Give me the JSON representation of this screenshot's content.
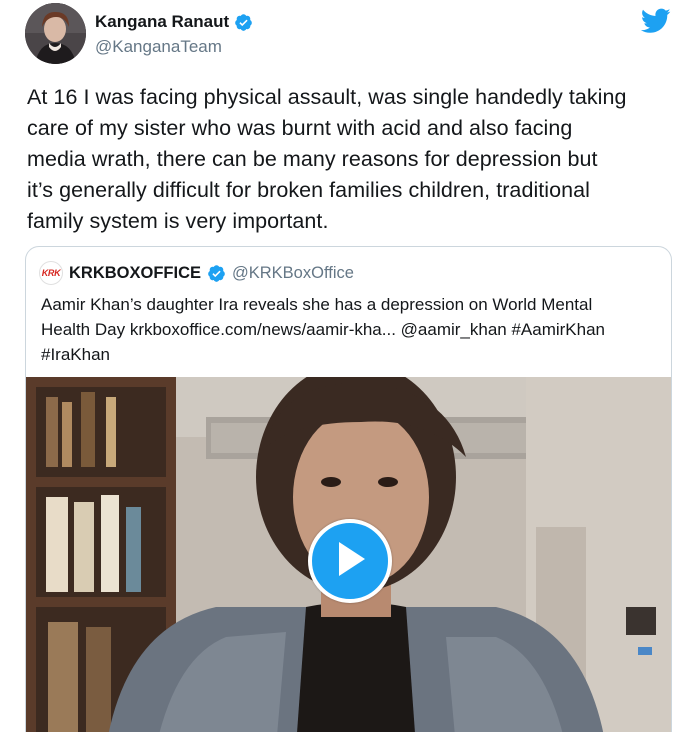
{
  "author": {
    "display_name": "Kangana Ranaut",
    "handle": "@KanganaTeam",
    "verified_icon": "verified-badge-icon"
  },
  "tweet": {
    "lines": [
      "At 16 I was facing physical assault, was single handedly taking",
      "care of my sister who was burnt with acid and also facing",
      "media wrath, there can be many reasons for depression but",
      "it’s generally difficult for broken families children, traditional",
      "family system is very important."
    ]
  },
  "quoted_tweet": {
    "avatar_text": "KRK",
    "display_name": "KRKBOXOFFICE",
    "handle": "@KRKBoxOffice",
    "lines": [
      "Aamir Khan’s daughter Ira reveals she has a depression on World Mental",
      "Health Day krkboxoffice.com/news/aamir-kha... @aamir_khan #AamirKhan",
      "#IraKhan"
    ],
    "media": {
      "type": "video",
      "play_icon": "play-icon"
    }
  },
  "icons": {
    "platform": "twitter-bird-icon"
  },
  "colors": {
    "accent": "#1da1f2",
    "text_primary": "#14171a",
    "text_secondary": "#657786",
    "border": "#ccd6dd"
  }
}
